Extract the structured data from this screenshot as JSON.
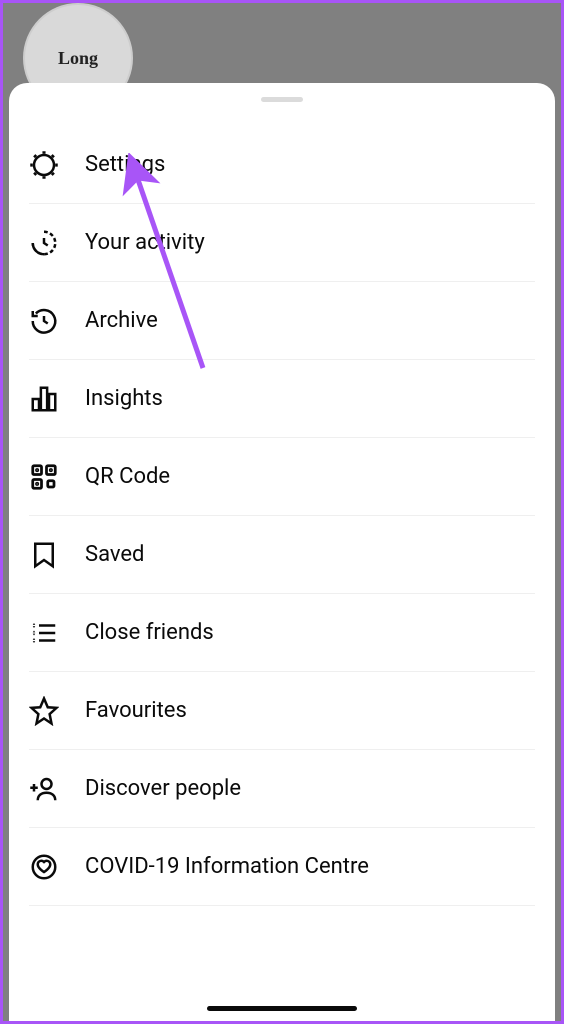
{
  "profile": {
    "avatar_label": "Long"
  },
  "menu": {
    "items": [
      {
        "label": "Settings"
      },
      {
        "label": "Your activity"
      },
      {
        "label": "Archive"
      },
      {
        "label": "Insights"
      },
      {
        "label": "QR Code"
      },
      {
        "label": "Saved"
      },
      {
        "label": "Close friends"
      },
      {
        "label": "Favourites"
      },
      {
        "label": "Discover people"
      },
      {
        "label": "COVID-19 Information Centre"
      }
    ]
  },
  "annotation": {
    "arrow_color": "#a855f7"
  }
}
